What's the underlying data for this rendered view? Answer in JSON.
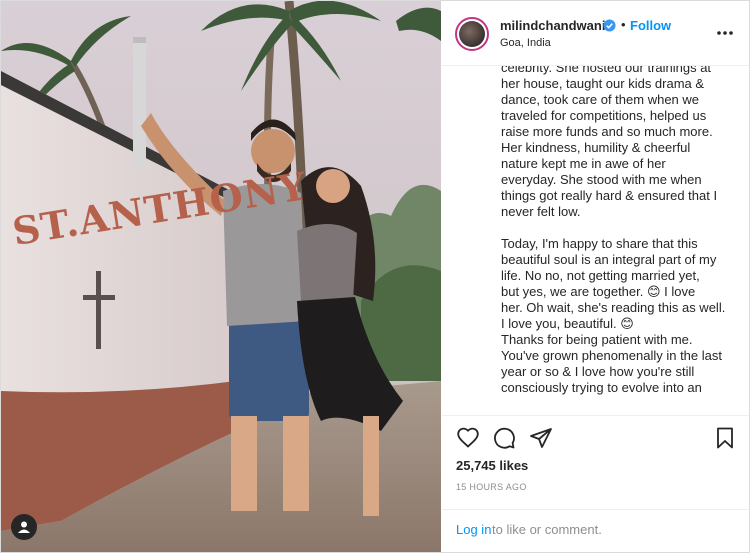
{
  "post": {
    "username": "milindchandwani",
    "separator": "•",
    "follow_label": "Follow",
    "location": "Goa, India",
    "photo_text": "ST.ANTHONY",
    "caption_lines_1": [
      "celebrity. She hosted our trainings at",
      "her house, taught our kids drama &",
      "dance, took care of them when we",
      "traveled for competitions, helped us",
      "raise more funds and so much more.",
      "Her kindness, humility & cheerful",
      "nature kept me in awe of her",
      "everyday. She stood with me when",
      "things got really hard & ensured that I",
      "never felt low."
    ],
    "caption_lines_2": [
      "Today, I'm happy to share that this",
      "beautiful soul is an integral part of my",
      "life. No no, not getting married yet,",
      "but yes, we are together. 😊 I love",
      "her. Oh wait, she's reading this as well.",
      "I love you, beautiful. 😊",
      "Thanks for being patient with me.",
      "You've grown phenomenally in the last",
      "year or so & I love how you're still",
      "consciously trying to evolve into an"
    ],
    "likes": "25,745 likes",
    "timestamp": "15 HOURS AGO",
    "login_link": "Log in",
    "login_rest": "to like or comment."
  },
  "icons": {
    "verified": "verified-badge-icon",
    "more": "more-options-icon",
    "like": "heart-icon",
    "comment": "comment-icon",
    "share": "paper-plane-icon",
    "save": "bookmark-icon",
    "tags": "user-tag-icon"
  },
  "colors": {
    "link_blue": "#0095f6",
    "text": "#262626",
    "muted": "#8e8e8e",
    "border": "#dbdbdb"
  }
}
